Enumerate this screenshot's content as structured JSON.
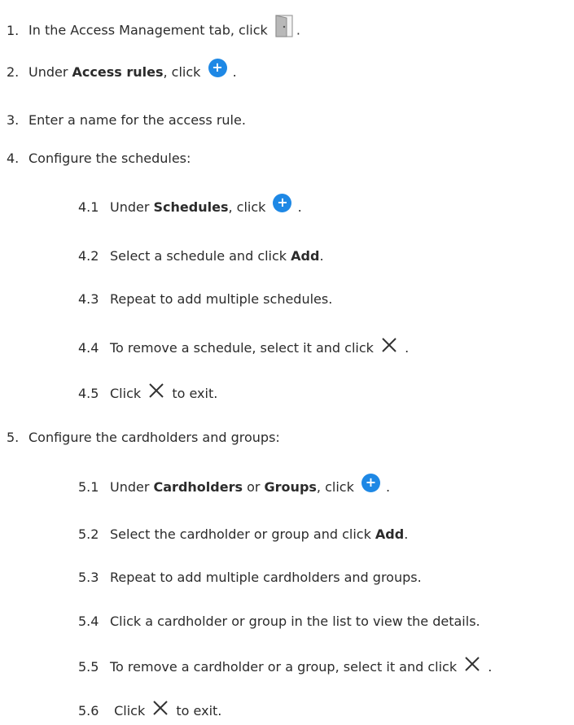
{
  "steps": [
    {
      "num": "1.",
      "pre": "In the Access Management tab, click",
      "post": "."
    },
    {
      "num": "2.",
      "pre": "Under ",
      "bold": "Access rules",
      "mid": ", click",
      "post": "."
    },
    {
      "num": "3.",
      "text": "Enter a name for the access rule."
    },
    {
      "num": "4.",
      "text": "Configure the schedules:"
    },
    {
      "num": "5.",
      "text": "Configure the cardholders and groups:"
    }
  ],
  "schedules": [
    {
      "num": "4.1",
      "pre": "Under ",
      "bold": "Schedules",
      "mid": ", click",
      "post": "."
    },
    {
      "num": "4.2",
      "pre": "Select a schedule and click ",
      "bold": "Add",
      "post": "."
    },
    {
      "num": "4.3",
      "text": "Repeat to add multiple schedules."
    },
    {
      "num": "4.4",
      "pre": "To remove a schedule, select it and click",
      "post": "."
    },
    {
      "num": "4.5",
      "pre": "Click",
      "post": "to exit."
    }
  ],
  "cardholders": [
    {
      "num": "5.1",
      "pre": "Under ",
      "bold": "Cardholders",
      "mid": " or ",
      "bold2": "Groups",
      "mid2": ", click",
      "post": "."
    },
    {
      "num": "5.2",
      "pre": "Select the cardholder or group and click ",
      "bold": "Add",
      "post": "."
    },
    {
      "num": "5.3",
      "text": "Repeat to add multiple cardholders and groups."
    },
    {
      "num": "5.4",
      "text": "Click a cardholder or group in the list to view the details."
    },
    {
      "num": "5.5",
      "pre": "To remove a cardholder or a group, select it and click",
      "post": "."
    },
    {
      "num": "5.6",
      "pre": " Click",
      "post": "to exit."
    }
  ],
  "icons": {
    "door": "door-icon",
    "add": "plus-circle-icon",
    "close": "close-x-icon",
    "add_glyph": "+"
  },
  "colors": {
    "accent": "#1e88e5",
    "text": "#2b2b2b"
  }
}
